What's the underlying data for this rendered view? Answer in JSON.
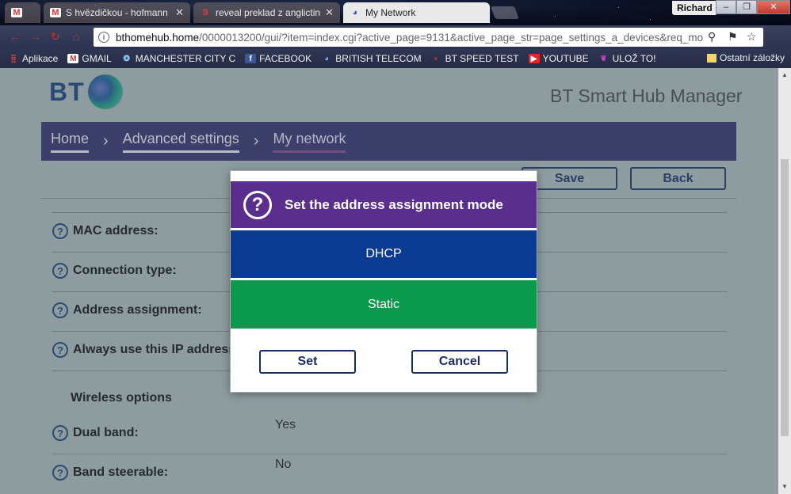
{
  "browser": {
    "tabs": [
      {
        "label": "",
        "icon": "gmail-icon"
      },
      {
        "label": "S hvězdičkou - hofmann",
        "icon": "gmail-icon"
      },
      {
        "label": "reveal preklad z anglictin",
        "icon": "seznam-icon"
      },
      {
        "label": "My Network",
        "icon": "bt-globe-icon"
      }
    ],
    "user": "Richard",
    "window_controls": [
      "–",
      "❐",
      "✕"
    ],
    "url_host": "bthomehub.home",
    "url_path": "/0000013200/gui/?item=index.cgi?active_page=9131&active_page_str=page_settings_a_devices&req_mo",
    "bookmarks": [
      "Aplikace",
      "GMAIL",
      "MANCHESTER CITY C",
      "FACEBOOK",
      "BRITISH TELECOM",
      "BT SPEED TEST",
      "YOUTUBE",
      "ULOŽ TO!"
    ],
    "bookmarks_other": "Ostatní záložky"
  },
  "page": {
    "logo_text": "BT",
    "hub_title": "BT Smart Hub Manager",
    "breadcrumbs": [
      "Home",
      "Advanced settings",
      "My network"
    ],
    "save_label": "Save",
    "back_label": "Back",
    "rows": [
      {
        "label": "MAC address:"
      },
      {
        "label": "Connection type:"
      },
      {
        "label": "Address assignment:"
      },
      {
        "label": "Always use this IP address:"
      }
    ],
    "wireless_section": "Wireless options",
    "wireless_rows": [
      {
        "label": "Dual band:",
        "value": "Yes"
      },
      {
        "label": "Band steerable:",
        "value": "No"
      }
    ]
  },
  "modal": {
    "title": "Set the address assignment mode",
    "options": [
      "DHCP",
      "Static"
    ],
    "set_label": "Set",
    "cancel_label": "Cancel"
  },
  "colors": {
    "modal_header": "#5a2e8c",
    "dhcp": "#0a3a92",
    "static": "#0a9a4e",
    "navbar": "#3b3f6a"
  }
}
